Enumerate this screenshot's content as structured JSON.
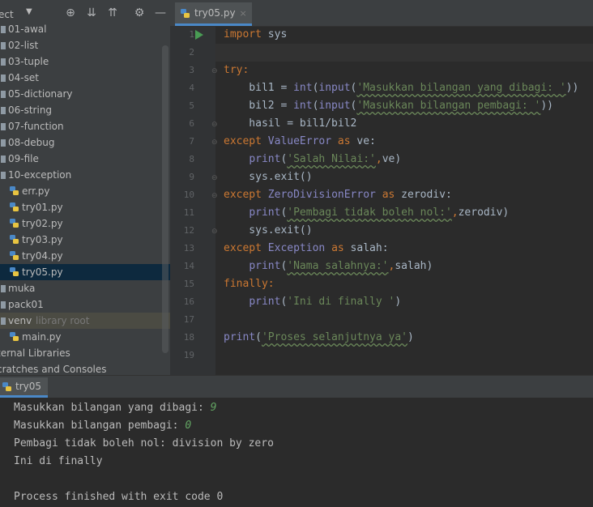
{
  "project": {
    "title": "ect",
    "tree": [
      {
        "label": "01-awal",
        "kind": "folder"
      },
      {
        "label": "02-list",
        "kind": "folder"
      },
      {
        "label": "03-tuple",
        "kind": "folder"
      },
      {
        "label": "04-set",
        "kind": "folder"
      },
      {
        "label": "05-dictionary",
        "kind": "folder"
      },
      {
        "label": "06-string",
        "kind": "folder"
      },
      {
        "label": "07-function",
        "kind": "folder"
      },
      {
        "label": "08-debug",
        "kind": "folder"
      },
      {
        "label": "09-file",
        "kind": "folder"
      },
      {
        "label": "10-exception",
        "kind": "folder"
      },
      {
        "label": "err.py",
        "kind": "py"
      },
      {
        "label": "try01.py",
        "kind": "py"
      },
      {
        "label": "try02.py",
        "kind": "py"
      },
      {
        "label": "try03.py",
        "kind": "py"
      },
      {
        "label": "try04.py",
        "kind": "py"
      },
      {
        "label": "try05.py",
        "kind": "py",
        "selected": true
      },
      {
        "label": "muka",
        "kind": "folder"
      },
      {
        "label": "pack01",
        "kind": "folder"
      },
      {
        "label": "venv",
        "kind": "folder",
        "note": "library root"
      },
      {
        "label": "main.py",
        "kind": "py"
      },
      {
        "label": "ternal Libraries",
        "kind": "lib"
      },
      {
        "label": "cratches and Consoles",
        "kind": "lib"
      }
    ]
  },
  "editor": {
    "tab_label": "try05.py",
    "tab_close": "×",
    "line_numbers": [
      "1",
      "2",
      "3",
      "4",
      "5",
      "6",
      "7",
      "8",
      "9",
      "10",
      "11",
      "12",
      "13",
      "14",
      "15",
      "16",
      "17",
      "18",
      "19"
    ],
    "code": {
      "l1_kw": "import",
      "l1_rest": " sys",
      "l3_kw": "try",
      "l4_a": "    bil1 = ",
      "l4_int": "int",
      "l4_b": "(",
      "l4_input": "input",
      "l4_c": "(",
      "l4_str": "'Masukkan bilangan yang dibagi: '",
      "l4_d": "))",
      "l5_a": "    bil2 = ",
      "l5_int": "int",
      "l5_b": "(",
      "l5_input": "input",
      "l5_c": "(",
      "l5_str": "'Masukkan bilangan pembagi: '",
      "l5_d": "))",
      "l6": "    hasil = bil1/bil2",
      "l7_kw": "except",
      "l7_cls": "ValueError",
      "l7_as": "as",
      "l7_rest": " ve:",
      "l8_print": "print",
      "l8_str": "'Salah Nilai:'",
      "l8_rest": "ve)",
      "l9": "    sys.exit()",
      "l10_kw": "except",
      "l10_cls": "ZeroDivisionError",
      "l10_as": "as",
      "l10_rest": " zerodiv:",
      "l11_print": "print",
      "l11_str": "'Pembagi tidak boleh nol:'",
      "l11_rest": "zerodiv)",
      "l12": "    sys.exit()",
      "l13_kw": "except",
      "l13_cls": "Exception",
      "l13_as": "as",
      "l13_rest": " salah:",
      "l14_print": "print",
      "l14_str": "'Nama salahnya:'",
      "l14_rest": "salah)",
      "l15_kw": "finally",
      "l16_print": "print",
      "l16_str": "'Ini di finally '",
      "l16_rest": ")",
      "l18_print": "print",
      "l18_str": "'Proses selanjutnya ya'",
      "l18_rest": ")"
    }
  },
  "run": {
    "tab_label": "try05",
    "lines": [
      {
        "text": "Masukkan bilangan yang dibagi: ",
        "input": "9"
      },
      {
        "text": "Masukkan bilangan pembagi: ",
        "input": "0"
      },
      {
        "text": "Pembagi tidak boleh nol: division by zero",
        "input": ""
      },
      {
        "text": "Ini di finally",
        "input": ""
      },
      {
        "text": "",
        "input": ""
      },
      {
        "text": "Process finished with exit code 0",
        "input": ""
      }
    ]
  },
  "colors": {
    "accent": "#4a88c7",
    "keyword": "#cc7832",
    "string": "#6a8759",
    "builtin": "#8888c6"
  }
}
